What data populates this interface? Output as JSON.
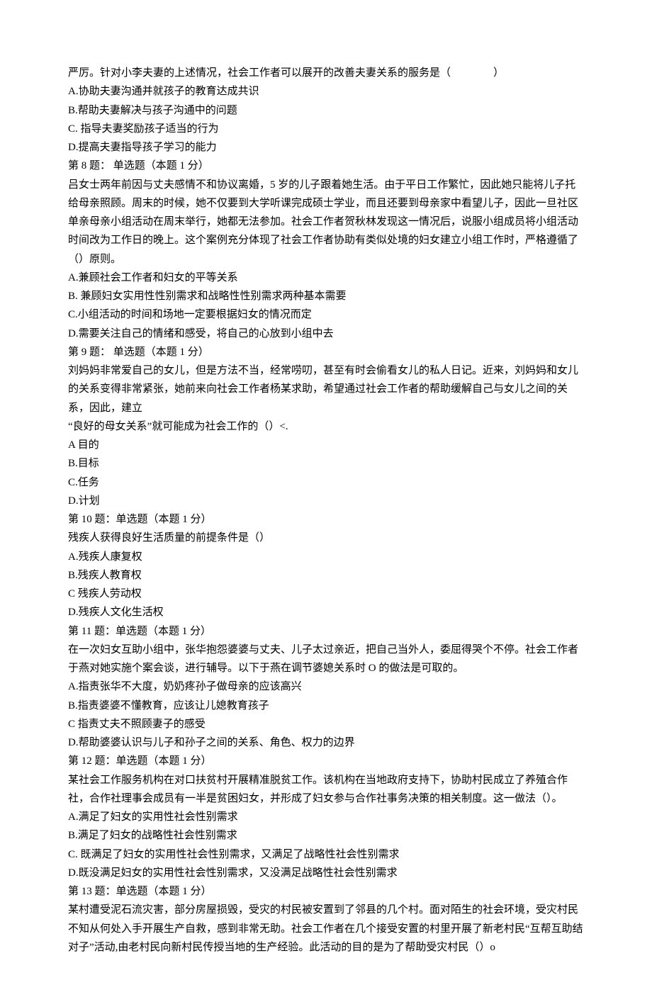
{
  "q7_partial": {
    "context": "严厉。针对小李夫妻的上述情况，社会工作者可以展开的改善夫妻关系的服务是（",
    "context_end": "）",
    "optA": "A.协助夫妻沟通并就孩子的教育达成共识",
    "optB": "B.帮助夫妻解决与孩子沟通中的问题",
    "optC": "C. 指导夫妻奖励孩子适当的行为",
    "optD": "D.提高夫妻指导孩子学习的能力"
  },
  "q8": {
    "header": "第 8 题： 单选题（本题 1 分）",
    "text1": "吕女士两年前因与丈夫感情不和协议离婚，5 岁的儿子跟着她生活。由于平日工作繁忙，因此她只能将儿子托给母亲照顾。周末的时候，她不仅要到大学听课完成硕士学业，而且还要到母亲家中看望儿子，因此一旦社区单亲母亲小组活动在周末举行，她都无法参加。社会工作者贺秋林发现这一情况后，说服小组成员将小组活动时间改为工作日的晚上。这个案例充分体现了社会工作者协助有类似处境的妇女建立小组工作时，严格遵循了（）原则。",
    "optA": "A.兼顾社会工作者和妇女的平等关系",
    "optB": "B. 兼顾妇女实用性性别需求和战略性性别需求两种基本需要",
    "optC": "C.小组活动的时间和场地一定要根据妇女的情况而定",
    "optD": "D.需要关注自己的情绪和感受，将自己的心放到小组中去"
  },
  "q9": {
    "header": "第 9 题： 单选题（本题 1 分）",
    "text1": "刘妈妈非常爱自己的女儿，但是方法不当，经常唠叨，甚至有时会偷看女儿的私人日记。近来，刘妈妈和女儿的关系变得非常紧张，她前来向社会工作者杨某求助，希望通过社会工作者的帮助缓解自己与女儿之间的关系，因此，建立",
    "text2": "“良好的母女关系”就可能成为社会工作的（）<.",
    "optA": "A 目的",
    "optB": "B.目标",
    "optC": "C.任务",
    "optD": "D.计划"
  },
  "q10": {
    "header": "第 10 题：单选题（本题 1 分）",
    "text1": "残疾人获得良好生活质量的前提条件是（）",
    "optA": "A.残疾人康复权",
    "optB": "B.残疾人教育权",
    "optC": "C 残疾人劳动权",
    "optD": "D.残疾人文化生活权"
  },
  "q11": {
    "header": "第 11 题：单选题（本题 1 分）",
    "text1": "在一次妇女互助小组中，张华抱怨婆婆与丈夫、儿子太过亲近，把自己当外人，委屈得哭个不停。社会工作者于燕对她实施个案会谈，进行辅导。以下于燕在调节婆媳关系时 O 的做法是可取的。",
    "optA": "A.指责张华不大度，奶奶疼孙子做母亲的应该高兴",
    "optB": "B.指责婆婆不懂教育，应该让儿媳教育孩子",
    "optC": "C 指责丈夫不照顾妻子的感受",
    "optD": "D.帮助婆婆认识与儿子和孙子之间的关系、角色、权力的边界"
  },
  "q12": {
    "header": "第 12 题：单选题（本题 1 分）",
    "text1": "某社会工作服务机构在对口扶贫村开展精准脱贫工作。该机构在当地政府支持下，协助村民成立了养殖合作社，合作社理事会成员有一半是贫困妇女，并形成了妇女参与合作社事务决策的相关制度。这一做法（）。",
    "optA": "A.满足了妇女的实用性社会性别需求",
    "optB": "B.满足了妇女的战略性社会性别需求",
    "optC": "C. 既满足了妇女的实用性社会性别需求，又满足了战略性社会性别需求",
    "optD": "D.既没满足妇女的实用性社会性别需求，又没满足战略性社会性别需求"
  },
  "q13": {
    "header": "第 13 题：单选题（本题 1 分）",
    "text1": "某村遭受泥石流灾害，部分房屋损毁，受灾的村民被安置到了邻县的几个村。面对陌生的社会环境，受灾村民不知从何处入手开展生产自救，感到非常无助。社会工作者在几个接受安置的村里开展了新老村民“互帮互助结对子”活动,由老村民向新村民传授当地的生产经验。此活动的目的是为了帮助受灾村民（）o"
  }
}
